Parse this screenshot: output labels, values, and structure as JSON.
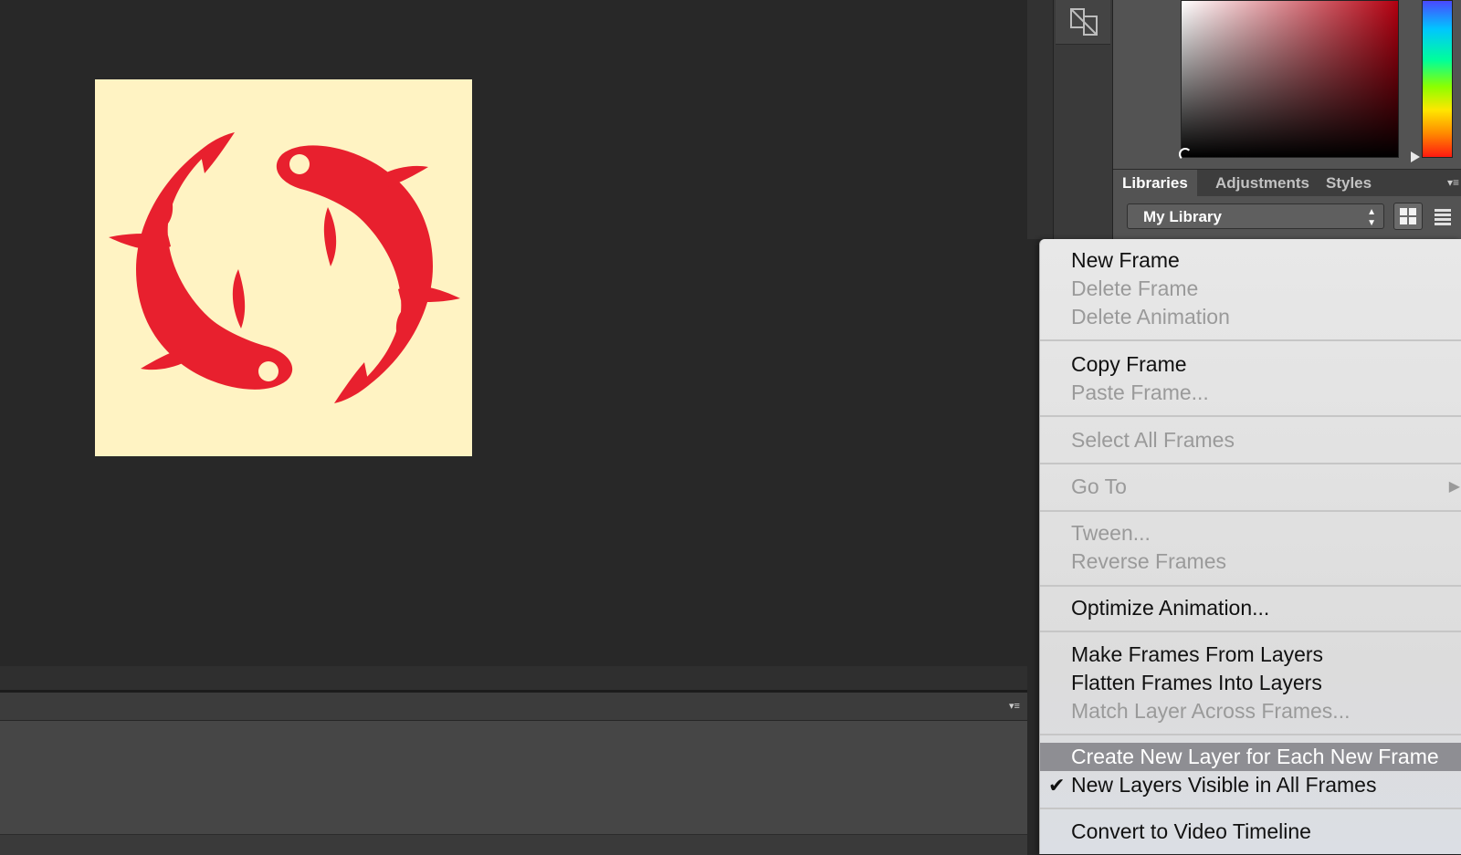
{
  "panel": {
    "tabs": [
      "Libraries",
      "Adjustments",
      "Styles"
    ],
    "library_select": "My Library"
  },
  "context_menu": {
    "new_frame": "New Frame",
    "delete_frame": "Delete Frame",
    "delete_animation": "Delete Animation",
    "copy_frame": "Copy Frame",
    "paste_frame": "Paste Frame...",
    "select_all_frames": "Select All Frames",
    "go_to": "Go To",
    "tween": "Tween...",
    "reverse_frames": "Reverse Frames",
    "optimize_animation": "Optimize Animation...",
    "make_frames_from_layers": "Make Frames From Layers",
    "flatten_frames_into_layers": "Flatten Frames Into Layers",
    "match_layer_across_frames": "Match Layer Across Frames...",
    "create_new_layer_each_frame": "Create New Layer for Each New Frame",
    "new_layers_visible": "New Layers Visible in All Frames",
    "convert_to_video_timeline": "Convert to Video Timeline"
  },
  "colors": {
    "artboard_bg": "#fff3c3",
    "fish_red": "#e8202e",
    "menu_highlight": "#8e8e93"
  },
  "icons": [
    "koi-fish-icon",
    "tool-dock-icon",
    "grid-view-icon",
    "list-view-icon",
    "panel-menu-icon",
    "submenu-arrow-icon",
    "checkmark-icon"
  ]
}
